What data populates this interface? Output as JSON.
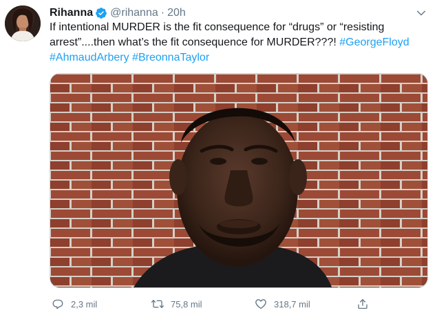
{
  "tweet": {
    "author_name": "Rihanna",
    "handle": "@rihanna",
    "separator": "·",
    "time": "20h",
    "text_plain": "If intentional MURDER is the fit consequence for “drugs” or “resisting arrest”....then what’s the fit consequence for MURDER???! ",
    "hashtags": [
      "#GeorgeFloyd",
      "#AhmaudArbery",
      "#BreonnaTaylor"
    ]
  },
  "actions": {
    "reply_count": "2,3 mil",
    "retweet_count": "75,8 mil",
    "like_count": "318,7 mil"
  },
  "icons": {
    "verified": "verified-badge-icon",
    "menu": "chevron-down-icon",
    "reply": "comment-icon",
    "retweet": "retweet-icon",
    "like": "heart-icon",
    "share": "share-icon"
  },
  "colors": {
    "accent": "#1da1f2",
    "text_primary": "#14171a",
    "text_secondary": "#657786",
    "border": "#ccd6dd"
  }
}
